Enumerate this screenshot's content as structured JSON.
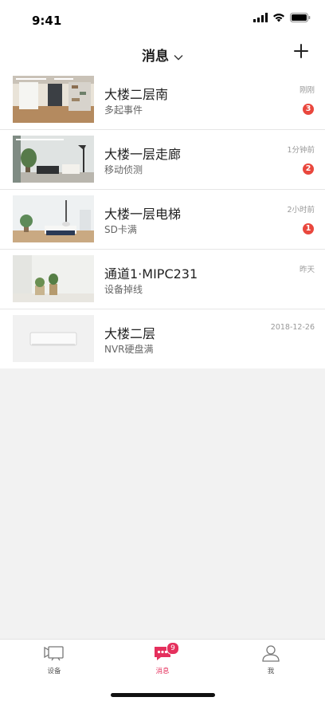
{
  "status_bar": {
    "time": "9:41"
  },
  "nav": {
    "title": "消息",
    "title_icon": "chevron-down-icon",
    "action_icon": "plus-icon"
  },
  "messages": [
    {
      "title": "大楼二层南",
      "subtitle": "多起事件",
      "time": "刚刚",
      "badge": "3",
      "thumb": "room-camera-view"
    },
    {
      "title": "大楼一层走廊",
      "subtitle": "移动侦测",
      "time": "1分钟前",
      "badge": "2",
      "thumb": "hallway-camera-view"
    },
    {
      "title": "大楼一层电梯",
      "subtitle": "SD卡满",
      "time": "2小时前",
      "badge": "1",
      "thumb": "bedroom-camera-view"
    },
    {
      "title": "通道1·MIPC231",
      "subtitle": "设备掉线",
      "time": "昨天",
      "badge": "",
      "thumb": "wall-plant-view"
    },
    {
      "title": "大楼二层",
      "subtitle": "NVR硬盘满",
      "time": "2018-12-26",
      "badge": "",
      "thumb": "nvr-device-image"
    }
  ],
  "tabs": [
    {
      "label": "设备",
      "icon": "camera-icon",
      "active": false
    },
    {
      "label": "消息",
      "icon": "message-icon",
      "active": true,
      "badge": "9"
    },
    {
      "label": "我",
      "icon": "person-icon",
      "active": false
    }
  ],
  "colors": {
    "accent": "#e5305d",
    "badge": "#e9473d",
    "background_gray": "#f2f2f2"
  }
}
